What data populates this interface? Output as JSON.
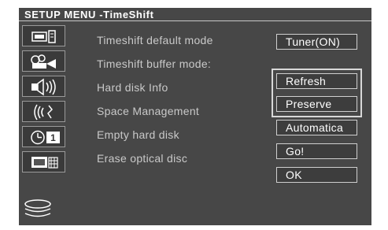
{
  "title": "SETUP  MENU -TimeShift",
  "left_icons": [
    {
      "name": "tv-icon"
    },
    {
      "name": "camera-icon"
    },
    {
      "name": "speaker-icon"
    },
    {
      "name": "signal-icon"
    },
    {
      "name": "timer-icon",
      "text": "1"
    },
    {
      "name": "monitor-keypad-icon"
    },
    {
      "name": "disc-stack-icon"
    }
  ],
  "menu_rows": [
    {
      "label": "Timeshift default mode",
      "value": "Tuner(ON)"
    },
    {
      "label": "Timeshift buffer mode:",
      "value": "Refresh"
    },
    {
      "label": "Hard disk Info",
      "value": "Preserve"
    },
    {
      "label": "Space Management",
      "value": "Automatica"
    },
    {
      "label": "Empty hard disk",
      "value": "Go!"
    },
    {
      "label": "Erase optical disc",
      "value": "OK"
    }
  ],
  "colors": {
    "background": "#474747",
    "label_text": "#c9c9c9",
    "value_text": "#ffffff",
    "box_border": "#cfcfcf"
  }
}
